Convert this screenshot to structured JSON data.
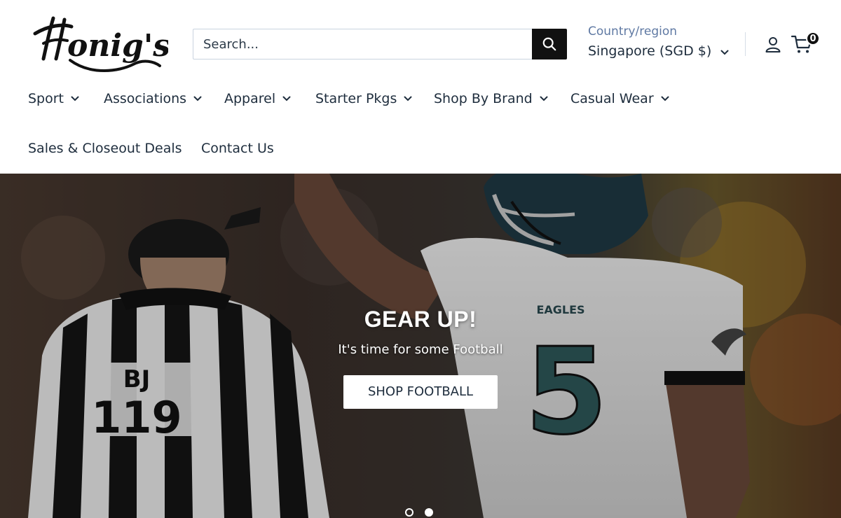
{
  "header": {
    "logo_text": "Honig's",
    "search": {
      "placeholder": "Search...",
      "value": ""
    },
    "region": {
      "label": "Country/region",
      "value": "Singapore (SGD $)"
    },
    "cart": {
      "count": "0"
    }
  },
  "nav": {
    "items": [
      {
        "label": "Sport",
        "has_dropdown": true
      },
      {
        "label": "Associations",
        "has_dropdown": true
      },
      {
        "label": "Apparel",
        "has_dropdown": true
      },
      {
        "label": "Starter Pkgs",
        "has_dropdown": true
      },
      {
        "label": "Shop By Brand",
        "has_dropdown": true
      },
      {
        "label": "Casual Wear",
        "has_dropdown": true
      },
      {
        "label": "Sales & Closeout Deals",
        "has_dropdown": false
      },
      {
        "label": "Contact Us",
        "has_dropdown": false
      }
    ]
  },
  "hero": {
    "title": "GEAR UP!",
    "subtitle": "It's time for some Football",
    "cta_label": "SHOP FOOTBALL",
    "slides": {
      "count": 2,
      "active_index": 1
    },
    "image_jersey_texts": [
      "BJ",
      "119",
      "5",
      "EAGLES"
    ]
  },
  "colors": {
    "text": "#1e2d3d",
    "region_label": "#5f79a3",
    "search_button": "#111111",
    "border": "#c9d3df"
  },
  "icons": [
    "search-icon",
    "chevron-down-icon",
    "user-icon",
    "cart-icon"
  ]
}
